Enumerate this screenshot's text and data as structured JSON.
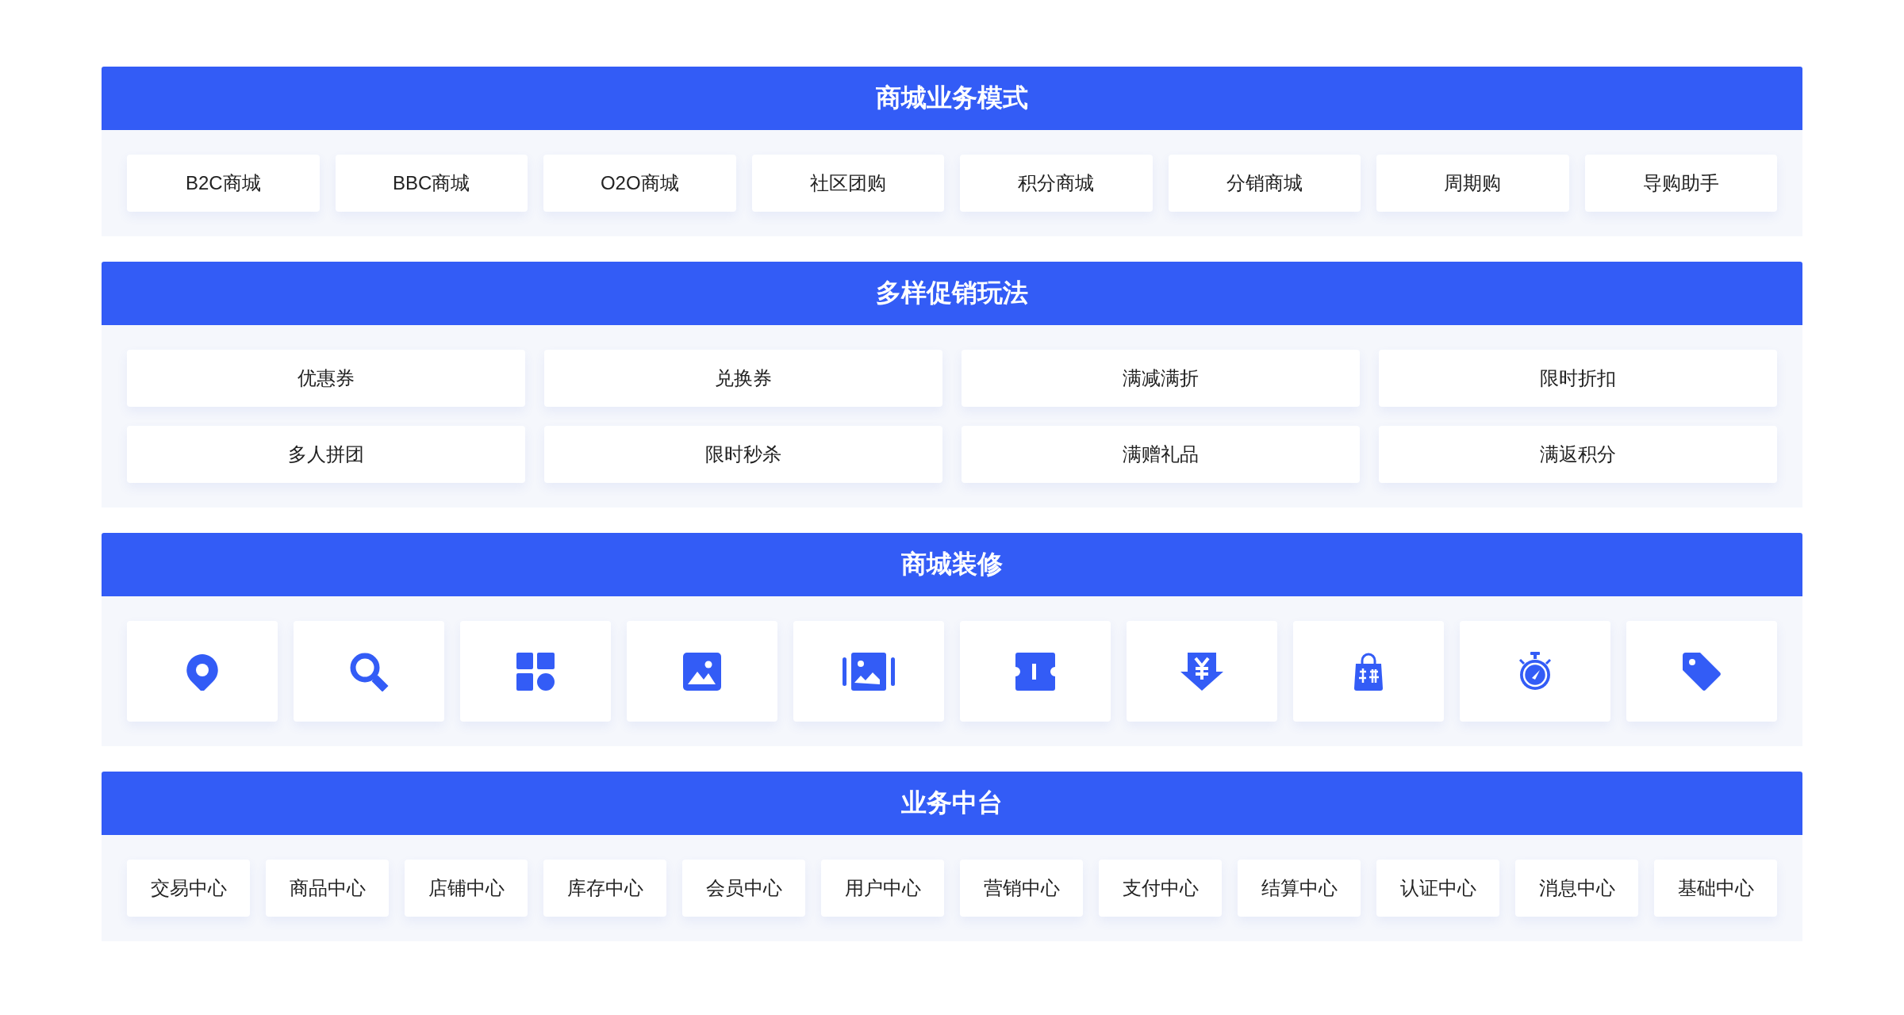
{
  "sections": [
    {
      "title": "商城业务模式",
      "kind": "row",
      "items": [
        "B2C商城",
        "BBC商城",
        "O2O商城",
        "社区团购",
        "积分商城",
        "分销商城",
        "周期购",
        "导购助手"
      ]
    },
    {
      "title": "多样促销玩法",
      "kind": "grid",
      "items": [
        "优惠券",
        "兑换券",
        "满减满折",
        "限时折扣",
        "多人拼团",
        "限时秒杀",
        "满赠礼品",
        "满返积分"
      ]
    },
    {
      "title": "商城装修",
      "kind": "icons"
    },
    {
      "title": "业务中台",
      "kind": "row",
      "items": [
        "交易中心",
        "商品中心",
        "店铺中心",
        "库存中心",
        "会员中心",
        "用户中心",
        "营销中心",
        "支付中心",
        "结算中心",
        "认证中心",
        "消息中心",
        "基础中心"
      ]
    }
  ]
}
